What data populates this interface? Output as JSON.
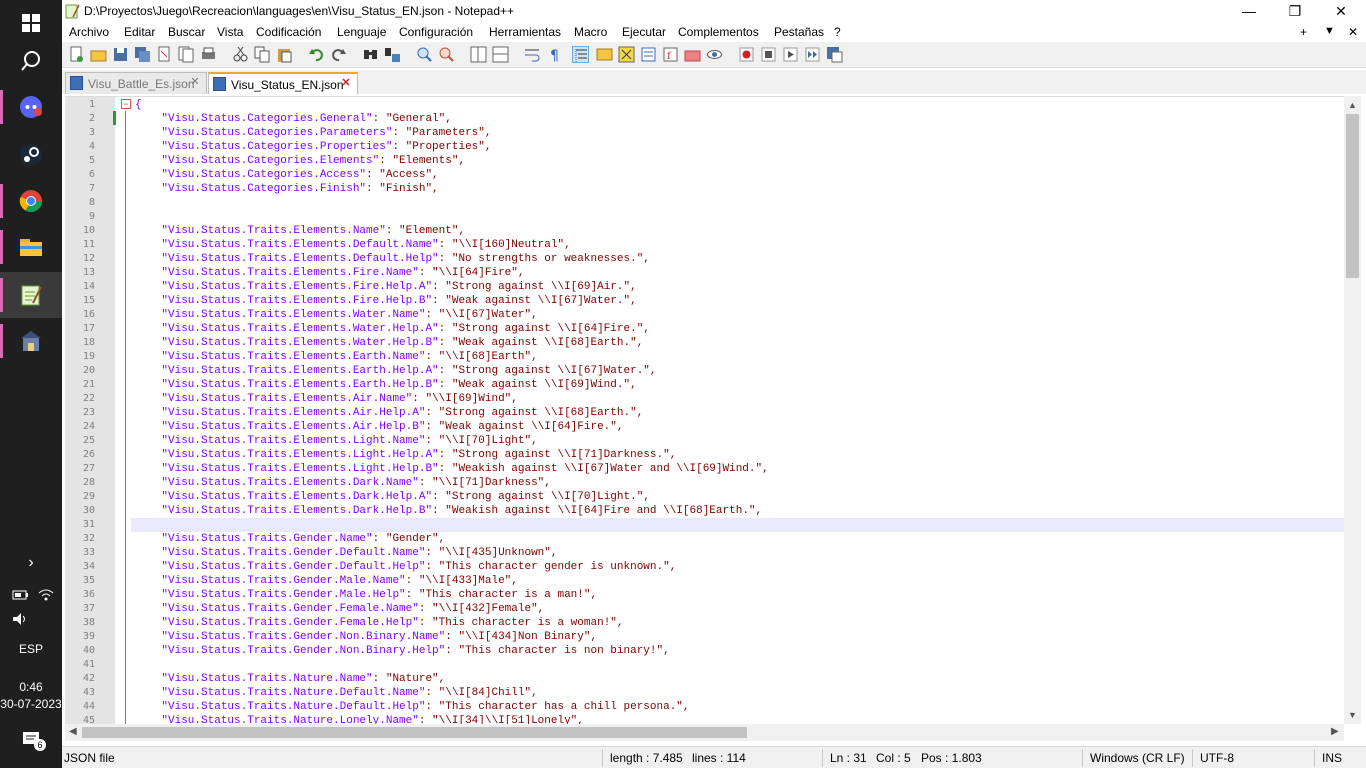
{
  "window": {
    "title": "D:\\Proyectos\\Juego\\Recreacion\\languages\\en\\Visu_Status_EN.json - Notepad++",
    "controls": {
      "minimize": "—",
      "maximize": "❐",
      "close": "✕"
    }
  },
  "menu": {
    "items": [
      "Archivo",
      "Editar",
      "Buscar",
      "Vista",
      "Codificación",
      "Lenguaje",
      "Configuración",
      "Herramientas",
      "Macro",
      "Ejecutar",
      "Complementos",
      "Pestañas",
      "?"
    ],
    "right": {
      "plus": "+",
      "down": "▼",
      "close": "✕"
    }
  },
  "tabs": [
    {
      "label": "Visu_Battle_Es.json",
      "active": false
    },
    {
      "label": "Visu_Status_EN.json",
      "active": true
    }
  ],
  "editor": {
    "current_line": 31,
    "lines": [
      {
        "n": "1",
        "k": "{",
        "v": ""
      },
      {
        "n": "2",
        "k": "    \"Visu.Status.Categories.General\"",
        "v": ": \"General\","
      },
      {
        "n": "3",
        "k": "    \"Visu.Status.Categories.Parameters\"",
        "v": ": \"Parameters\","
      },
      {
        "n": "4",
        "k": "    \"Visu.Status.Categories.Properties\"",
        "v": ": \"Properties\","
      },
      {
        "n": "5",
        "k": "    \"Visu.Status.Categories.Elements\"",
        "v": ": \"Elements\","
      },
      {
        "n": "6",
        "k": "    \"Visu.Status.Categories.Access\"",
        "v": ": \"Access\","
      },
      {
        "n": "7",
        "k": "    \"Visu.Status.Categories.Finish\"",
        "v": ": \"Finish\","
      },
      {
        "n": "8",
        "k": "",
        "v": ""
      },
      {
        "n": "9",
        "k": "",
        "v": ""
      },
      {
        "n": "10",
        "k": "    \"Visu.Status.Traits.Elements.Name\"",
        "v": ": \"Element\","
      },
      {
        "n": "11",
        "k": "    \"Visu.Status.Traits.Elements.Default.Name\"",
        "v": ": \"\\\\I[160]Neutral\","
      },
      {
        "n": "12",
        "k": "    \"Visu.Status.Traits.Elements.Default.Help\"",
        "v": ": \"No strengths or weaknesses.\","
      },
      {
        "n": "13",
        "k": "    \"Visu.Status.Traits.Elements.Fire.Name\"",
        "v": ": \"\\\\I[64]Fire\","
      },
      {
        "n": "14",
        "k": "    \"Visu.Status.Traits.Elements.Fire.Help.A\"",
        "v": ": \"Strong against \\\\I[69]Air.\","
      },
      {
        "n": "15",
        "k": "    \"Visu.Status.Traits.Elements.Fire.Help.B\"",
        "v": ": \"Weak against \\\\I[67]Water.\","
      },
      {
        "n": "16",
        "k": "    \"Visu.Status.Traits.Elements.Water.Name\"",
        "v": ": \"\\\\I[67]Water\","
      },
      {
        "n": "17",
        "k": "    \"Visu.Status.Traits.Elements.Water.Help.A\"",
        "v": ": \"Strong against \\\\I[64]Fire.\","
      },
      {
        "n": "18",
        "k": "    \"Visu.Status.Traits.Elements.Water.Help.B\"",
        "v": ": \"Weak against \\\\I[68]Earth.\","
      },
      {
        "n": "19",
        "k": "    \"Visu.Status.Traits.Elements.Earth.Name\"",
        "v": ": \"\\\\I[68]Earth\","
      },
      {
        "n": "20",
        "k": "    \"Visu.Status.Traits.Elements.Earth.Help.A\"",
        "v": ": \"Strong against \\\\I[67]Water.\","
      },
      {
        "n": "21",
        "k": "    \"Visu.Status.Traits.Elements.Earth.Help.B\"",
        "v": ": \"Weak against \\\\I[69]Wind.\","
      },
      {
        "n": "22",
        "k": "    \"Visu.Status.Traits.Elements.Air.Name\"",
        "v": ": \"\\\\I[69]Wind\","
      },
      {
        "n": "23",
        "k": "    \"Visu.Status.Traits.Elements.Air.Help.A\"",
        "v": ": \"Strong against \\\\I[68]Earth.\","
      },
      {
        "n": "24",
        "k": "    \"Visu.Status.Traits.Elements.Air.Help.B\"",
        "v": ": \"Weak against \\\\I[64]Fire.\","
      },
      {
        "n": "25",
        "k": "    \"Visu.Status.Traits.Elements.Light.Name\"",
        "v": ": \"\\\\I[70]Light\","
      },
      {
        "n": "26",
        "k": "    \"Visu.Status.Traits.Elements.Light.Help.A\"",
        "v": ": \"Strong against \\\\I[71]Darkness.\","
      },
      {
        "n": "27",
        "k": "    \"Visu.Status.Traits.Elements.Light.Help.B\"",
        "v": ": \"Weakish against \\\\I[67]Water and \\\\I[69]Wind.\","
      },
      {
        "n": "28",
        "k": "    \"Visu.Status.Traits.Elements.Dark.Name\"",
        "v": ": \"\\\\I[71]Darkness\","
      },
      {
        "n": "29",
        "k": "    \"Visu.Status.Traits.Elements.Dark.Help.A\"",
        "v": ": \"Strong against \\\\I[70]Light.\","
      },
      {
        "n": "30",
        "k": "    \"Visu.Status.Traits.Elements.Dark.Help.B\"",
        "v": ": \"Weakish against \\\\I[64]Fire and \\\\I[68]Earth.\","
      },
      {
        "n": "31",
        "k": "",
        "v": ""
      },
      {
        "n": "32",
        "k": "    \"Visu.Status.Traits.Gender.Name\"",
        "v": ": \"Gender\","
      },
      {
        "n": "33",
        "k": "    \"Visu.Status.Traits.Gender.Default.Name\"",
        "v": ": \"\\\\I[435]Unknown\","
      },
      {
        "n": "34",
        "k": "    \"Visu.Status.Traits.Gender.Default.Help\"",
        "v": ": \"This character gender is unknown.\","
      },
      {
        "n": "35",
        "k": "    \"Visu.Status.Traits.Gender.Male.Name\"",
        "v": ": \"\\\\I[433]Male\","
      },
      {
        "n": "36",
        "k": "    \"Visu.Status.Traits.Gender.Male.Help\"",
        "v": ": \"This character is a man!\","
      },
      {
        "n": "37",
        "k": "    \"Visu.Status.Traits.Gender.Female.Name\"",
        "v": ": \"\\\\I[432]Female\","
      },
      {
        "n": "38",
        "k": "    \"Visu.Status.Traits.Gender.Female.Help\"",
        "v": ": \"This character is a woman!\","
      },
      {
        "n": "39",
        "k": "    \"Visu.Status.Traits.Gender.Non.Binary.Name\"",
        "v": ": \"\\\\I[434]Non Binary\","
      },
      {
        "n": "40",
        "k": "    \"Visu.Status.Traits.Gender.Non.Binary.Help\"",
        "v": ": \"This character is non binary!\","
      },
      {
        "n": "41",
        "k": "",
        "v": ""
      },
      {
        "n": "42",
        "k": "    \"Visu.Status.Traits.Nature.Name\"",
        "v": ": \"Nature\","
      },
      {
        "n": "43",
        "k": "    \"Visu.Status.Traits.Nature.Default.Name\"",
        "v": ": \"\\\\I[84]Chill\","
      },
      {
        "n": "44",
        "k": "    \"Visu.Status.Traits.Nature.Default.Help\"",
        "v": ": \"This character has a chill persona.\","
      },
      {
        "n": "45",
        "k": "    \"Visu.Status.Traits.Nature.Lonely.Name\"",
        "v": ": \"\\\\I[34]\\\\I[51]Lonely\","
      }
    ]
  },
  "statusbar": {
    "filetype": "JSON file",
    "length": "length : 7.485",
    "lines": "lines : 114",
    "ln": "Ln : 31",
    "col": "Col : 5",
    "pos": "Pos : 1.803",
    "eol": "Windows (CR LF)",
    "encoding": "UTF-8",
    "mode": "INS"
  },
  "taskbar": {
    "language": "ESP",
    "time": "0:46",
    "date": "30-07-2023",
    "notifications": "6"
  },
  "colors": {
    "key": "#8000ff",
    "value": "#800000",
    "gutter": "#e4e4e4",
    "current_line": "#e8e8ff",
    "taskbar": "#1f1f1f"
  }
}
